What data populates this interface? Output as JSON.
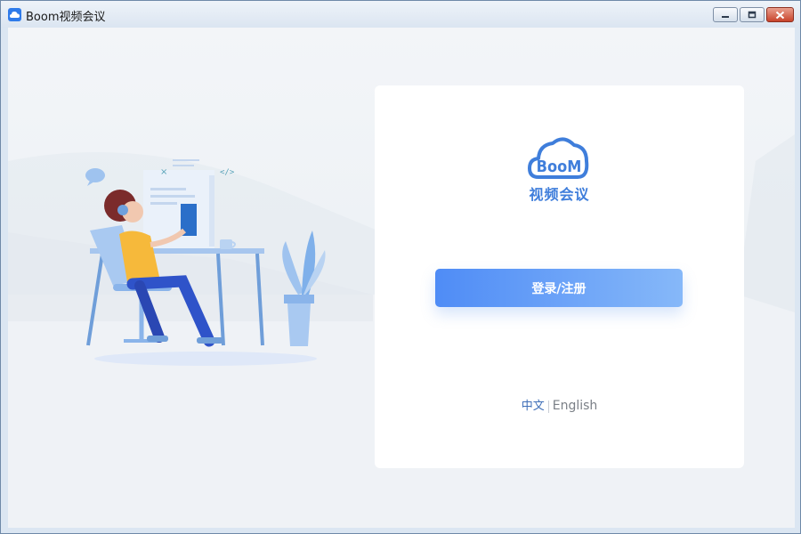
{
  "window": {
    "title": "Boom视频会议",
    "minimize_glyph": "‒",
    "maximize_glyph": "□",
    "close_glyph": "✕"
  },
  "login_card": {
    "logo_word": "BooM",
    "logo_subtitle": "视频会议",
    "login_button": "登录/注册"
  },
  "language": {
    "chinese": "中文",
    "english": "English",
    "selected": "中文"
  },
  "colors": {
    "accent": "#4f8cf6",
    "accent_light": "#86b8f9",
    "logo": "#3f7edb"
  }
}
